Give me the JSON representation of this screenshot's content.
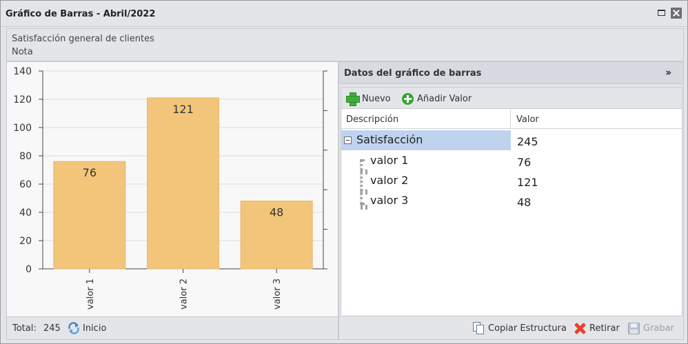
{
  "window": {
    "title": "Gráfico de Barras - Abril/2022",
    "maximize_icon": "maximize-icon",
    "close_icon": "close-icon"
  },
  "header": {
    "title": "Satisfacción general de clientes",
    "subtitle": "Nota"
  },
  "chart_data": {
    "type": "bar",
    "categories": [
      "valor 1",
      "valor 2",
      "valor 3"
    ],
    "values": [
      76,
      121,
      48
    ],
    "ylim": [
      0,
      140
    ],
    "yticks": [
      0,
      20,
      40,
      60,
      80,
      100,
      120,
      140
    ],
    "grid": true,
    "data_labels": true,
    "bar_color": "#f2c57b"
  },
  "footer_left": {
    "total_label": "Total:",
    "total_value": "245",
    "inicio_label": "Inicio",
    "inicio_icon": "refresh-icon"
  },
  "data_panel": {
    "title": "Datos del gráfico de barras",
    "collapse_icon": "double-chevron-right-icon",
    "toolbar": {
      "nuevo_label": "Nuevo",
      "anadir_label": "Añadir Valor"
    },
    "columns": [
      "Descripción",
      "Valor"
    ],
    "root": {
      "label": "Satisfacción",
      "value": "245"
    },
    "children": [
      {
        "label": "valor 1",
        "value": "76"
      },
      {
        "label": "valor 2",
        "value": "121"
      },
      {
        "label": "valor 3",
        "value": "48"
      }
    ],
    "footer": {
      "copiar_label": "Copiar Estructura",
      "retirar_label": "Retirar",
      "grabar_label": "Grabar"
    }
  },
  "colors": {
    "bar": "#f2c57b",
    "selection": "#bfd3ef",
    "panel_bg": "#e3e5e8"
  }
}
